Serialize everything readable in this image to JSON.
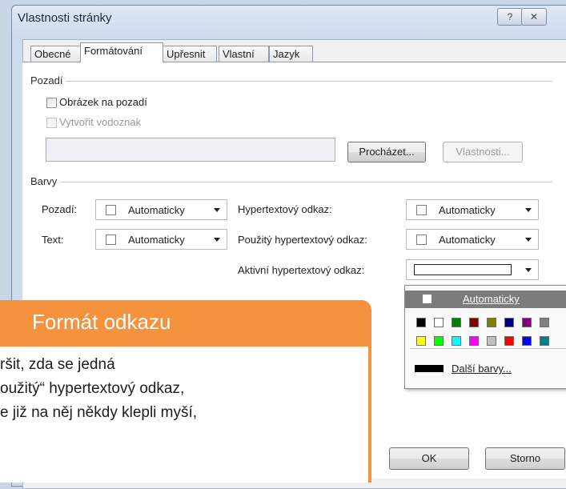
{
  "dialog": {
    "title": "Vlastnosti stránky",
    "help_button": "?",
    "close_button": "✕"
  },
  "tabs": [
    {
      "label": "Obecné"
    },
    {
      "label": "Formátování"
    },
    {
      "label": "Upřesnit"
    },
    {
      "label": "Vlastní"
    },
    {
      "label": "Jazyk"
    }
  ],
  "background_group": {
    "title": "Pozadí",
    "background_picture_label": "Obrázek na pozadí",
    "watermark_label": "Vytvořit vodoznak",
    "path_value": "",
    "browse_button": "Procházet...",
    "properties_button": "Vlastnosti..."
  },
  "colors_group": {
    "title": "Barvy",
    "background_label": "Pozadí:",
    "background_value": "Automaticky",
    "text_label": "Text:",
    "text_value": "Automaticky",
    "hyperlink_label": "Hypertextový odkaz:",
    "hyperlink_value": "Automaticky",
    "followed_label": "Použitý hypertextový odkaz:",
    "followed_value": "Automaticky",
    "active_label": "Aktivní hypertextový odkaz:"
  },
  "color_popup": {
    "automatic_label": "Automaticky",
    "more_colors_label": "Další barvy...",
    "row1": [
      "#000000",
      "#ffffff",
      "#008000",
      "#800000",
      "#808000",
      "#000080",
      "#800080",
      "#808080"
    ],
    "row2": [
      "#ffff00",
      "#00ff00",
      "#00ffff",
      "#ff00ff",
      "#c0c0c0",
      "#ff0000",
      "#0000ff",
      "#008080"
    ]
  },
  "footer": {
    "ok_button": "OK",
    "cancel_button": "Storno"
  },
  "callout": {
    "title": "Formát odkazu",
    "line1": "ršit, zda se jedná",
    "line2": "oužitý“ hypertextový odkaz,",
    "line3": "e již na něj někdy klepli myší,"
  },
  "colors": {
    "accent_orange": "#f5923e",
    "popup_header": "#7b7b7b"
  }
}
